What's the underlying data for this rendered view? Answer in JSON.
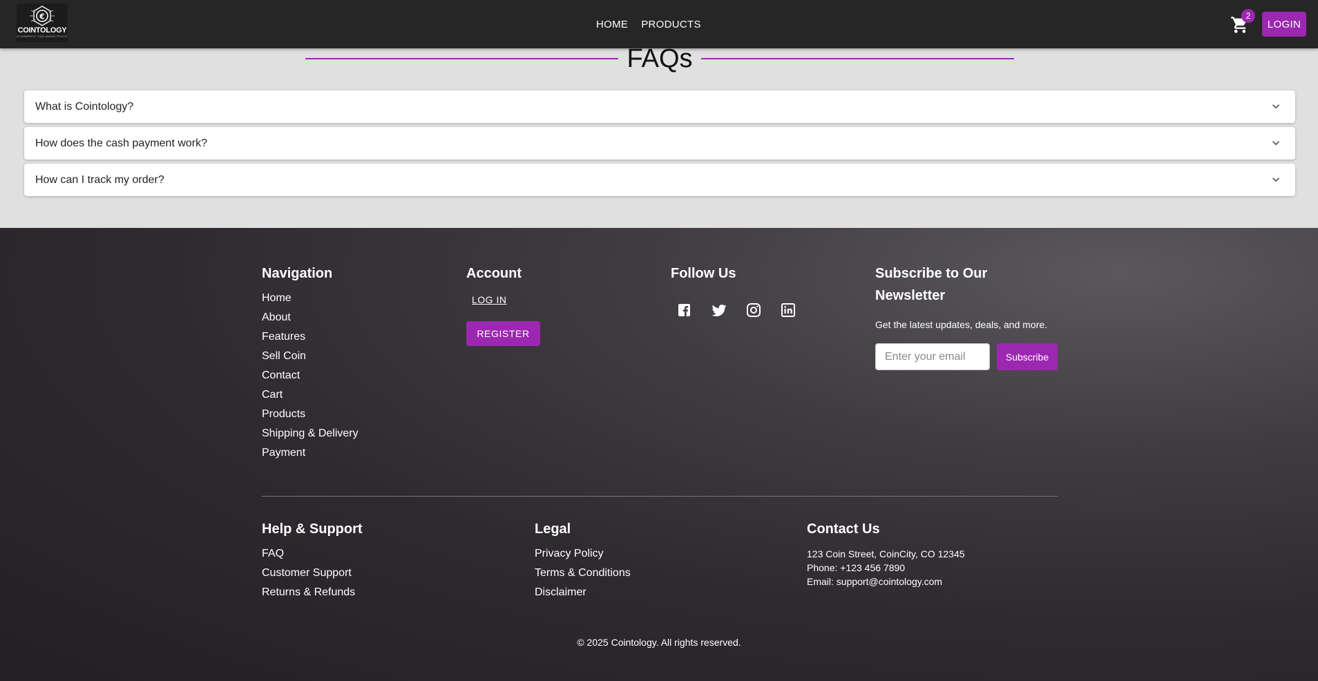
{
  "header": {
    "logo_text": "COINTOLOGY",
    "logo_sub": "ECOMMERCE COIN MARKETPLACE",
    "nav": [
      "HOME",
      "PRODUCTS"
    ],
    "cart_count": "2",
    "login_label": "LOGIN"
  },
  "faq": {
    "title": "FAQs",
    "items": [
      "What is Cointology?",
      "How does the cash payment work?",
      "How can I track my order?"
    ]
  },
  "footer": {
    "navigation": {
      "title": "Navigation",
      "links": [
        "Home",
        "About",
        "Features",
        "Sell Coin",
        "Contact",
        "Cart",
        "Products",
        "Shipping & Delivery",
        "Payment"
      ]
    },
    "account": {
      "title": "Account",
      "login_label": "LOG IN",
      "register_label": "REGISTER"
    },
    "follow": {
      "title": "Follow Us",
      "icons": [
        "facebook-icon",
        "twitter-icon",
        "instagram-icon",
        "linkedin-icon"
      ]
    },
    "newsletter": {
      "title": "Subscribe to Our Newsletter",
      "description": "Get the latest updates, deals, and more.",
      "placeholder": "Enter your email",
      "button": "Subscribe"
    },
    "help": {
      "title": "Help & Support",
      "links": [
        "FAQ",
        "Customer Support",
        "Returns & Refunds"
      ]
    },
    "legal": {
      "title": "Legal",
      "links": [
        "Privacy Policy",
        "Terms & Conditions",
        "Disclaimer"
      ]
    },
    "contact": {
      "title": "Contact Us",
      "address": "123 Coin Street, CoinCity, CO 12345",
      "phone": "Phone: +123 456 7890",
      "email": "Email: support@cointology.com"
    },
    "copyright": "© 2025 Cointology. All rights reserved."
  },
  "colors": {
    "accent": "#9c27b0",
    "header_bg": "#262626",
    "page_bg": "#e0e0e0"
  }
}
